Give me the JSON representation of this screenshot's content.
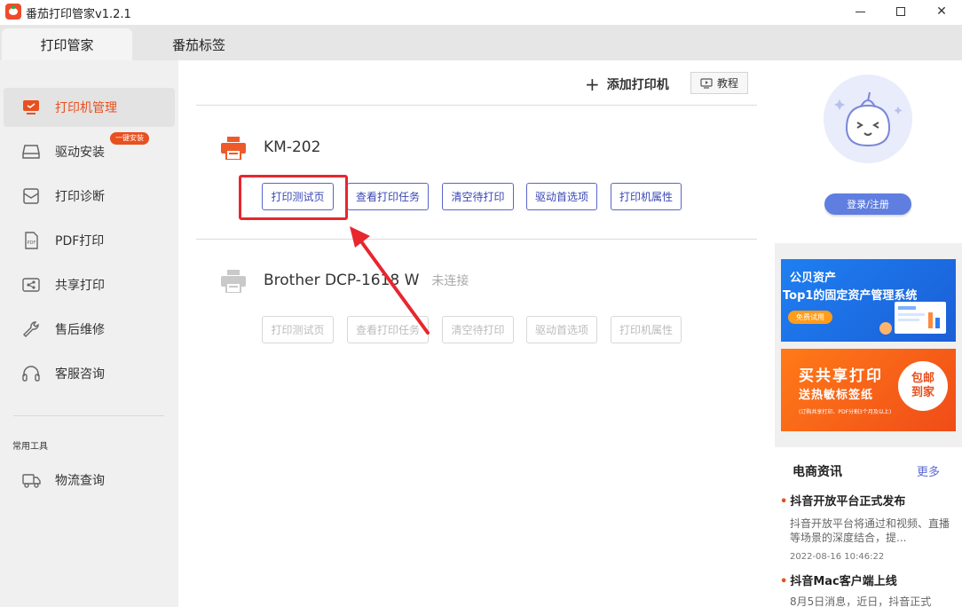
{
  "window": {
    "title": "番茄打印管家v1.2.1",
    "minimize_icon": "minimize-icon",
    "maximize_icon": "maximize-icon",
    "close_glyph": "✕"
  },
  "tabs": [
    {
      "label": "打印管家",
      "active": true
    },
    {
      "label": "番茄标签",
      "active": false
    }
  ],
  "sidebar": {
    "items": [
      {
        "label": "打印机管理",
        "icon": "monitor-icon",
        "active": true
      },
      {
        "label": "驱动安装",
        "icon": "drive-icon",
        "badge": "一键安装"
      },
      {
        "label": "打印诊断",
        "icon": "diagnose-icon"
      },
      {
        "label": "PDF打印",
        "icon": "pdf-icon"
      },
      {
        "label": "共享打印",
        "icon": "share-icon"
      },
      {
        "label": "售后维修",
        "icon": "wrench-icon"
      },
      {
        "label": "客服咨询",
        "icon": "headset-icon"
      }
    ],
    "section_label": "常用工具",
    "tools": [
      {
        "label": "物流查询",
        "icon": "truck-icon"
      }
    ]
  },
  "toolbar": {
    "add_plus": "+",
    "add_printer_label": "添加打印机",
    "tutorial_label": "教程"
  },
  "printers": [
    {
      "name": "KM-202",
      "status": "",
      "connected": true,
      "actions": [
        "打印测试页",
        "查看打印任务",
        "清空待打印",
        "驱动首选项",
        "打印机属性"
      ]
    },
    {
      "name": "Brother DCP-1618 W",
      "status": "未连接",
      "connected": false,
      "actions": [
        "打印测试页",
        "查看打印任务",
        "清空待打印",
        "驱动首选项",
        "打印机属性"
      ]
    }
  ],
  "colors": {
    "accent": "#e8501f",
    "button_border": "#5a65c9",
    "highlight": "#e8262e"
  },
  "profile": {
    "login_label": "登录/注册"
  },
  "ads": [
    {
      "brand": "公贝资产",
      "title": "Top1的固定资产管理系统",
      "button": "免费试用"
    },
    {
      "title": "买共享打印",
      "subtitle": "送热敏标签纸",
      "note": "(订购共享打印、PDF分割3个月及以上)",
      "circle_line1": "包邮",
      "circle_line2": "到家"
    }
  ],
  "news": {
    "title": "电商资讯",
    "more": "更多",
    "items": [
      {
        "dot": "•",
        "headline": "抖音开放平台正式发布",
        "body": "抖音开放平台将通过和视频、直播等场景的深度结合，提...",
        "date": "2022-08-16 10:46:22"
      },
      {
        "dot": "•",
        "headline": "抖音Mac客户端上线",
        "body": "8月5日消息，近日，抖音正式"
      }
    ]
  }
}
